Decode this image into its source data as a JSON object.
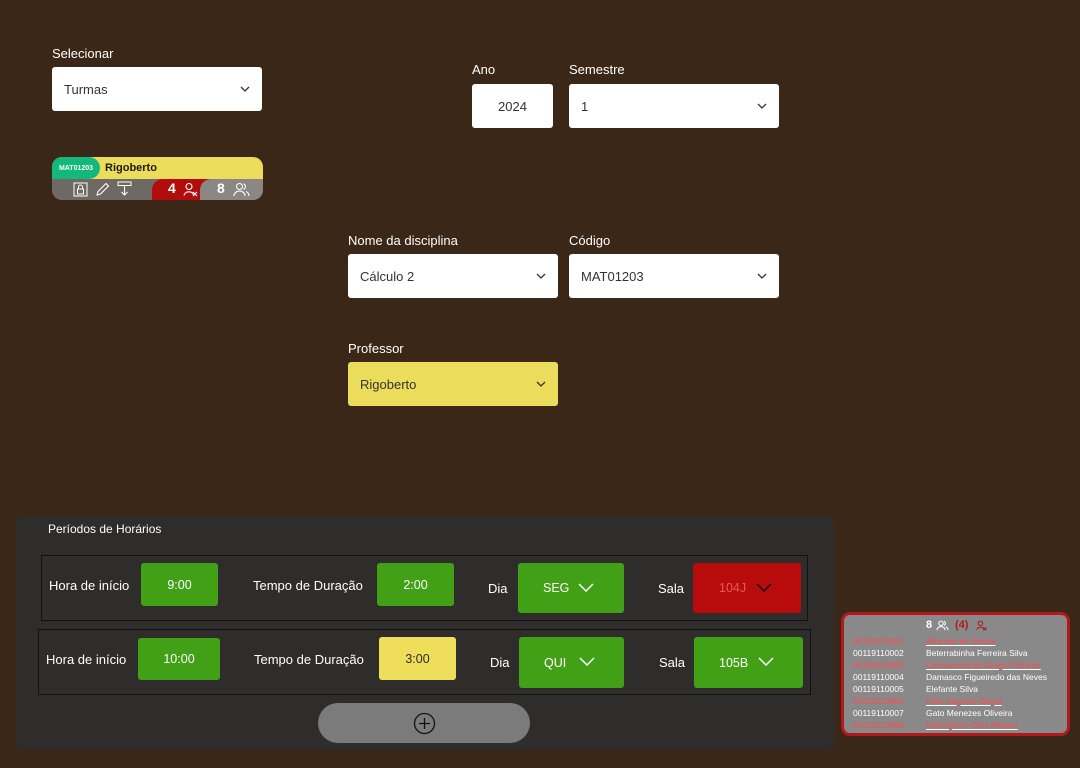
{
  "selector": {
    "label": "Selecionar",
    "value": "Turmas"
  },
  "period": {
    "year_label": "Ano",
    "year_value": "2024",
    "semester_label": "Semestre",
    "semester_value": "1"
  },
  "class_card": {
    "code": "MAT01203",
    "professor": "Rigoberto",
    "absent_count": "4",
    "student_count": "8",
    "colors": {
      "code": "#13b87d",
      "professor": "#ecdc5b",
      "absent": "#b20d0d",
      "students": "#8a8784"
    }
  },
  "course": {
    "name_label": "Nome da disciplina",
    "name_value": "Cálculo 2",
    "code_label": "Código",
    "code_value": "MAT01203",
    "professor_label": "Professor",
    "professor_value": "Rigoberto"
  },
  "schedule": {
    "title": "Períodos de Horários",
    "rows": [
      {
        "start_label": "Hora de início",
        "start": "9:00",
        "duration_label": "Tempo de Duração",
        "duration": "2:00",
        "day_label": "Dia",
        "day": "SEG",
        "room_label": "Sala",
        "room": "104J",
        "room_status": "conflict"
      },
      {
        "start_label": "Hora de início",
        "start": "10:00",
        "duration_label": "Tempo de Duração",
        "duration": "3:00",
        "day_label": "Dia",
        "day": "QUI",
        "room_label": "Sala",
        "room": "105B",
        "room_status": "ok"
      }
    ]
  },
  "students_popup": {
    "count": "8",
    "absent": "(4)",
    "students": [
      {
        "id": "00119110001",
        "name": "Abacate de Souza",
        "highlight": true
      },
      {
        "id": "00119110002",
        "name": "Beterrabinha Ferreira Silva",
        "highlight": false
      },
      {
        "id": "00119110003",
        "name": "Cenourinha da Graça Pinheiro",
        "highlight": true
      },
      {
        "id": "00119110004",
        "name": "Damasco Figueiredo das Neves",
        "highlight": false
      },
      {
        "id": "00119110005",
        "name": "Elefante Silva",
        "highlight": false
      },
      {
        "id": "00119110006",
        "name": "Feliz Augusto Degel",
        "highlight": true
      },
      {
        "id": "00119110007",
        "name": "Gato Menezes Oliveira",
        "highlight": false
      },
      {
        "id": "00119110008",
        "name": "Helicoptero Dias Ribeiro",
        "highlight": true
      }
    ]
  },
  "icons": [
    "chevron-down-icon",
    "lock-icon",
    "pencil-icon",
    "download-icon",
    "user-x-icon",
    "users-icon",
    "plus-circle-icon"
  ]
}
